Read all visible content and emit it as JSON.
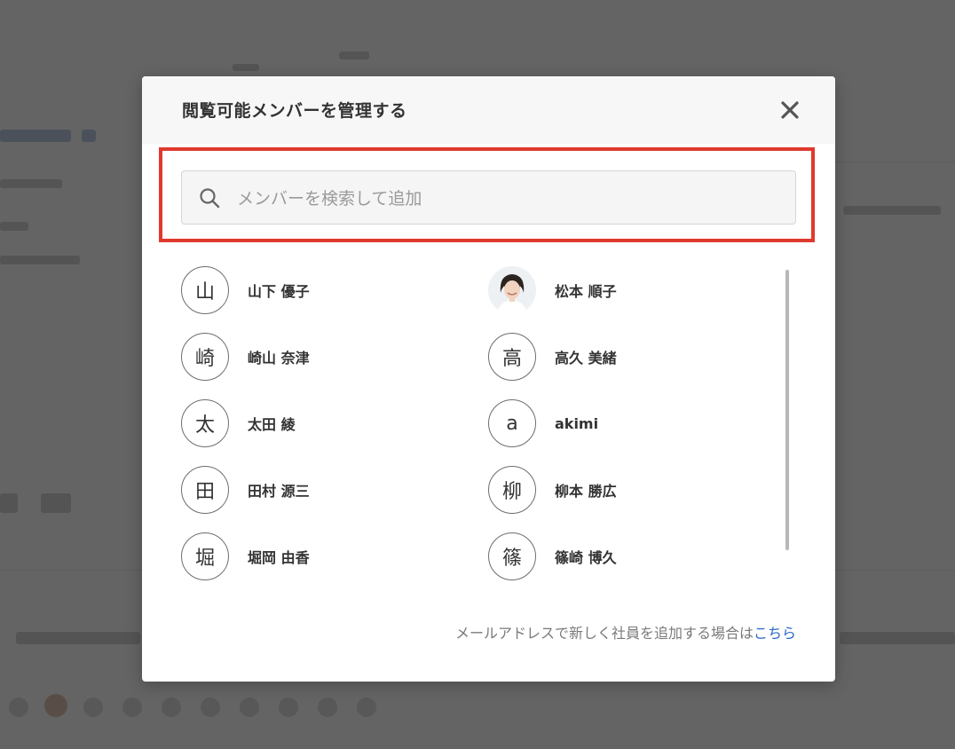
{
  "modal": {
    "title": "閲覧可能メンバーを管理する",
    "close_icon": "close-icon",
    "search": {
      "placeholder": "メンバーを検索して追加",
      "value": "",
      "icon": "search-icon"
    },
    "members_left": [
      {
        "avatar": "山",
        "name": "山下 優子"
      },
      {
        "avatar": "崎",
        "name": "崎山 奈津"
      },
      {
        "avatar": "太",
        "name": "太田 綾"
      },
      {
        "avatar": "田",
        "name": "田村 源三"
      },
      {
        "avatar": "堀",
        "name": "堀岡 由香"
      }
    ],
    "members_right": [
      {
        "avatar": "",
        "avatar_type": "photo",
        "name": "松本 順子"
      },
      {
        "avatar": "高",
        "name": "高久 美緒"
      },
      {
        "avatar": "a",
        "name": "akimi"
      },
      {
        "avatar": "柳",
        "name": "柳本 勝広"
      },
      {
        "avatar": "篠",
        "name": "篠崎 博久"
      }
    ],
    "footer": {
      "text": "メールアドレスで新しく社員を追加する場合は",
      "link": "こちら"
    }
  },
  "colors": {
    "highlight": "#e03a2e",
    "link": "#2a6ac8",
    "overlay": "rgba(40,40,40,0.70)"
  }
}
